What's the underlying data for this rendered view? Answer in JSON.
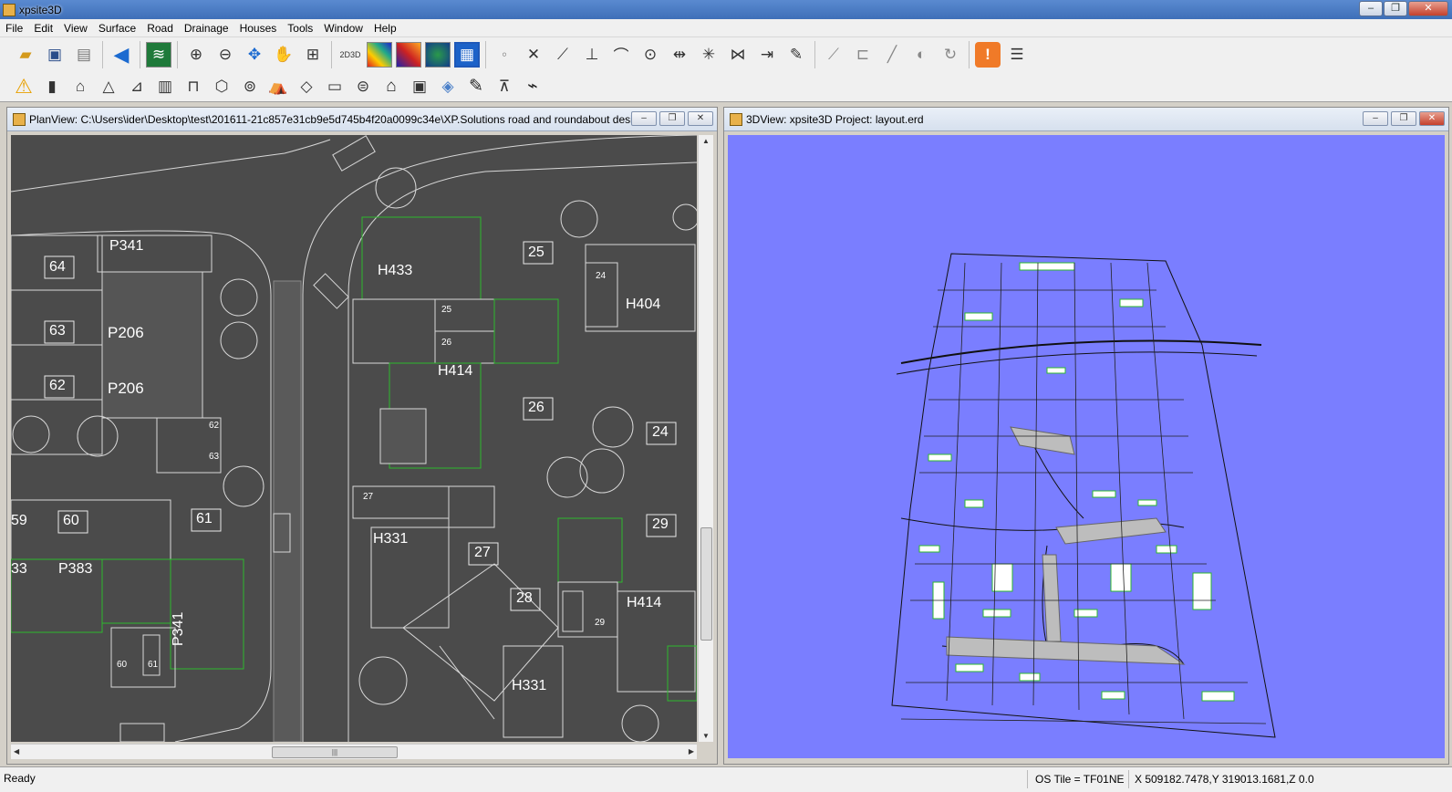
{
  "app": {
    "title": "xpsite3D"
  },
  "menus": [
    "File",
    "Edit",
    "View",
    "Surface",
    "Road",
    "Drainage",
    "Houses",
    "Tools",
    "Window",
    "Help"
  ],
  "plan_view": {
    "title": "PlanView: C:\\Users\\ider\\Desktop\\test\\201611-21c857e31cb9e5d745b4f20a0099c34e\\XP.Solutions road and roundabout desi...",
    "labels": {
      "p341_top": "P341",
      "n64": "64",
      "n63": "63",
      "n62": "62",
      "p206_a": "P206",
      "p206_b": "P206",
      "n62_small": "62",
      "n63_small": "63",
      "n59": "59",
      "n60": "60",
      "n61": "61",
      "n33": "33",
      "p383": "P383",
      "p341_vert": "P341",
      "n60_small": "60",
      "n61_small": "61",
      "h433": "H433",
      "n25": "25",
      "n25_small": "25",
      "n26_small": "26",
      "h414_a": "H414",
      "n26": "26",
      "n24_small": "24",
      "h404": "H404",
      "n24": "24",
      "n27_small": "27",
      "h331_a": "H331",
      "n27": "27",
      "n29": "29",
      "n28": "28",
      "n29_small": "29",
      "h414_b": "H414",
      "h331_b": "H331",
      "n2d": "2D",
      "n3d_small": "26"
    }
  },
  "view_3d": {
    "title": "3DView: xpsite3D Project: layout.erd",
    "background": "#7a7eff"
  },
  "status": {
    "ready": "Ready",
    "os_tile": "OS Tile = TF01NE",
    "coords": "X 509182.7478,Y 319013.1681,Z 0.0"
  },
  "toolbar": {
    "labels": {
      "two_d_three_d": "2D3D"
    }
  }
}
